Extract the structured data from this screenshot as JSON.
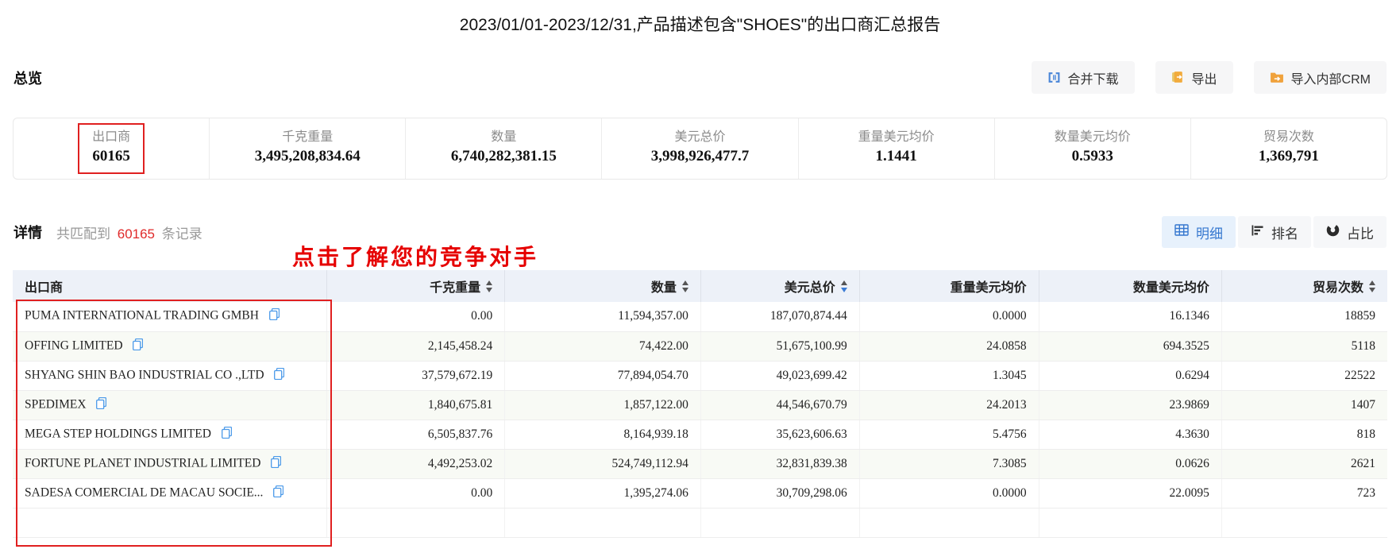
{
  "title": "2023/01/01-2023/12/31,产品描述包含\"SHOES\"的出口商汇总报告",
  "overview": {
    "label": "总览",
    "stats": [
      {
        "label": "出口商",
        "value": "60165",
        "highlighted": true
      },
      {
        "label": "千克重量",
        "value": "3,495,208,834.64"
      },
      {
        "label": "数量",
        "value": "6,740,282,381.15"
      },
      {
        "label": "美元总价",
        "value": "3,998,926,477.7"
      },
      {
        "label": "重量美元均价",
        "value": "1.1441"
      },
      {
        "label": "数量美元均价",
        "value": "0.5933"
      },
      {
        "label": "贸易次数",
        "value": "1,369,791"
      }
    ]
  },
  "toolbar": {
    "merge_download": "合并下载",
    "export": "导出",
    "import_crm": "导入内部CRM"
  },
  "detail": {
    "label": "详情",
    "match_prefix": "共匹配到",
    "match_count": "60165",
    "match_suffix": "条记录",
    "annotation": "点击了解您的竞争对手"
  },
  "view_toggles": {
    "detail": "明细",
    "ranking": "排名",
    "share": "占比"
  },
  "table": {
    "columns": [
      {
        "label": "出口商"
      },
      {
        "label": "千克重量",
        "sortable": true
      },
      {
        "label": "数量",
        "sortable": true
      },
      {
        "label": "美元总价",
        "sortable": true,
        "sort": "desc"
      },
      {
        "label": "重量美元均价"
      },
      {
        "label": "数量美元均价"
      },
      {
        "label": "贸易次数",
        "sortable": true
      }
    ],
    "col_widths": [
      "22.85%",
      "12.95%",
      "14.25%",
      "11.55%",
      "13.05%",
      "13.3%",
      "12.05%"
    ],
    "rows": [
      {
        "exporter": "PUMA INTERNATIONAL TRADING GMBH",
        "values": [
          "0.00",
          "11,594,357.00",
          "187,070,874.44",
          "0.0000",
          "16.1346",
          "18859"
        ]
      },
      {
        "exporter": "OFFING LIMITED",
        "values": [
          "2,145,458.24",
          "74,422.00",
          "51,675,100.99",
          "24.0858",
          "694.3525",
          "5118"
        ]
      },
      {
        "exporter": "SHYANG SHIN BAO INDUSTRIAL CO .,LTD",
        "values": [
          "37,579,672.19",
          "77,894,054.70",
          "49,023,699.42",
          "1.3045",
          "0.6294",
          "22522"
        ]
      },
      {
        "exporter": "SPEDIMEX",
        "values": [
          "1,840,675.81",
          "1,857,122.00",
          "44,546,670.79",
          "24.2013",
          "23.9869",
          "1407"
        ]
      },
      {
        "exporter": "MEGA STEP HOLDINGS LIMITED",
        "values": [
          "6,505,837.76",
          "8,164,939.18",
          "35,623,606.63",
          "5.4756",
          "4.3630",
          "818"
        ]
      },
      {
        "exporter": "FORTUNE PLANET INDUSTRIAL LIMITED",
        "values": [
          "4,492,253.02",
          "524,749,112.94",
          "32,831,839.38",
          "7.3085",
          "0.0626",
          "2621"
        ]
      },
      {
        "exporter": "SADESA COMERCIAL DE MACAU SOCIE...",
        "values": [
          "0.00",
          "1,395,274.06",
          "30,709,298.06",
          "0.0000",
          "22.0095",
          "723"
        ]
      }
    ]
  },
  "colors": {
    "accent_blue": "#3a7bd5",
    "icon_blue": "#4a90d9",
    "icon_orange": "#f0a83a",
    "annotation_red": "#e60000",
    "count_red": "#e02b2b",
    "header_bg": "#edf1f8",
    "row_alt_bg": "#f8faf5"
  }
}
